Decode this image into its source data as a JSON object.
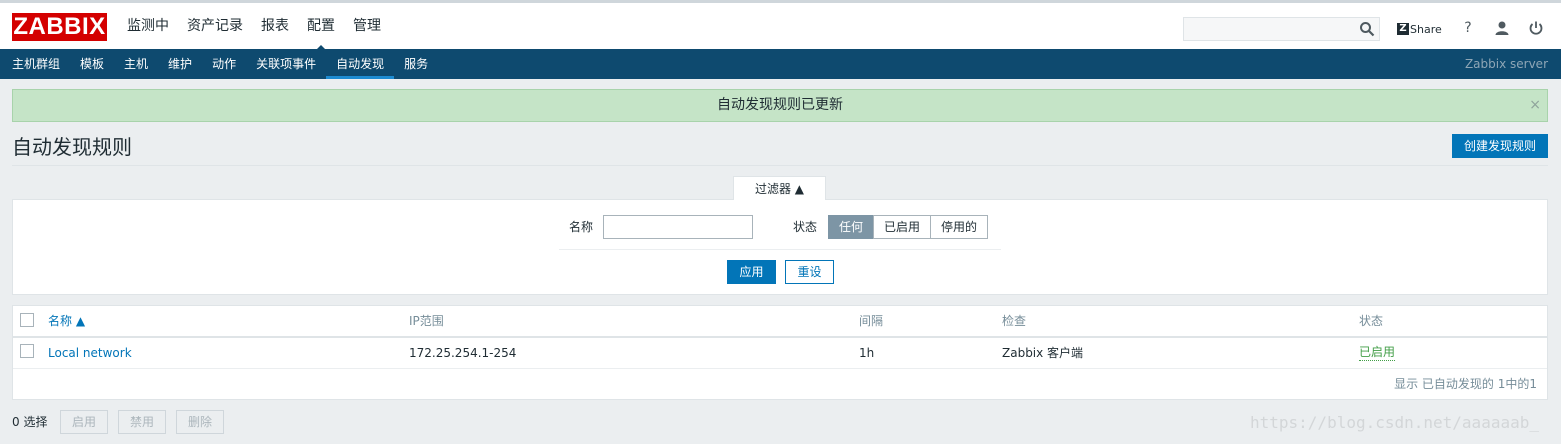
{
  "header": {
    "logo": "ZABBIX",
    "menu": [
      "监测中",
      "资产记录",
      "报表",
      "配置",
      "管理"
    ],
    "active_menu_index": 3,
    "search": {
      "value": "",
      "placeholder": ""
    },
    "share_label": "Share",
    "icons": [
      "search-icon",
      "help-icon",
      "user-icon",
      "power-icon"
    ]
  },
  "subnav": {
    "items": [
      "主机群组",
      "模板",
      "主机",
      "维护",
      "动作",
      "关联项事件",
      "自动发现",
      "服务"
    ],
    "active_index": 6,
    "server": "Zabbix server"
  },
  "message": {
    "text": "自动发现规则已更新",
    "close": "×"
  },
  "page": {
    "title": "自动发现规则",
    "create_button": "创建发现规则"
  },
  "filter": {
    "tab_label": "过滤器 ▲",
    "name_label": "名称",
    "name_value": "",
    "status_label": "状态",
    "status_options": [
      "任何",
      "已启用",
      "停用的"
    ],
    "status_selected": "任何",
    "apply": "应用",
    "reset": "重设"
  },
  "table": {
    "headers": {
      "name": "名称 ▲",
      "ip_range": "IP范围",
      "interval": "间隔",
      "checks": "检查",
      "status": "状态"
    },
    "rows": [
      {
        "name": "Local network",
        "ip_range": "172.25.254.1-254",
        "interval": "1h",
        "checks": "Zabbix 客户端",
        "status": "已启用"
      }
    ],
    "footer": "显示 已自动发现的 1中的1"
  },
  "actions": {
    "selected": "0 选择",
    "enable": "启用",
    "disable": "禁用",
    "delete": "删除"
  },
  "watermark": "https://blog.csdn.net/aaaaaab_",
  "colors": {
    "brand": "#d40000",
    "nav": "#0e4a6f",
    "accent": "#0275b8",
    "success_bg": "#c5e4c7",
    "enabled": "#429e47"
  }
}
